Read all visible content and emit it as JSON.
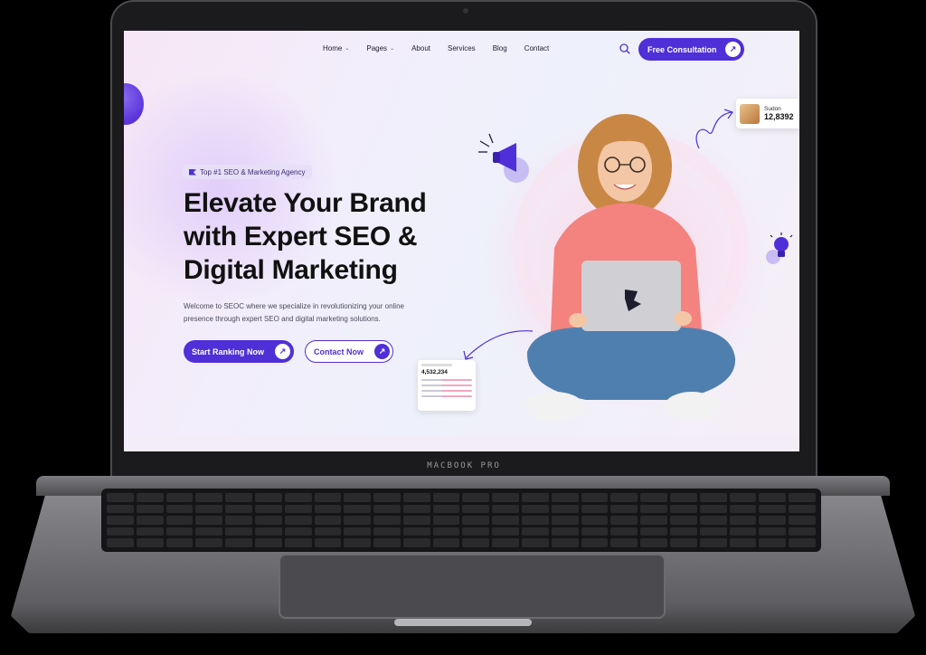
{
  "laptop": {
    "brand_label": "MACBOOK PRO"
  },
  "nav": {
    "items": [
      {
        "label": "Home",
        "has_dropdown": true
      },
      {
        "label": "Pages",
        "has_dropdown": true
      },
      {
        "label": "About",
        "has_dropdown": false
      },
      {
        "label": "Services",
        "has_dropdown": false
      },
      {
        "label": "Blog",
        "has_dropdown": false
      },
      {
        "label": "Contact",
        "has_dropdown": false
      }
    ],
    "search_icon": "search-icon",
    "cta_label": "Free Consultation"
  },
  "hero": {
    "badge": "Top #1 SEO & Marketing Agency",
    "headline_line1": "Elevate Your Brand",
    "headline_line2": "with Expert SEO &",
    "headline_line3": "Digital Marketing",
    "description_line1": "Welcome to SEOC where we specialize in revolutionizing your online",
    "description_line2": "presence through expert SEO and digital marketing solutions.",
    "primary_button": "Start Ranking Now",
    "secondary_button": "Contact Now"
  },
  "stats_card": {
    "value": "4,532,234"
  },
  "profile_card": {
    "name": "Sudon",
    "value": "12,8392"
  },
  "colors": {
    "brand": "#4f2fd8",
    "background": "#f2eefb",
    "text": "#111111"
  }
}
